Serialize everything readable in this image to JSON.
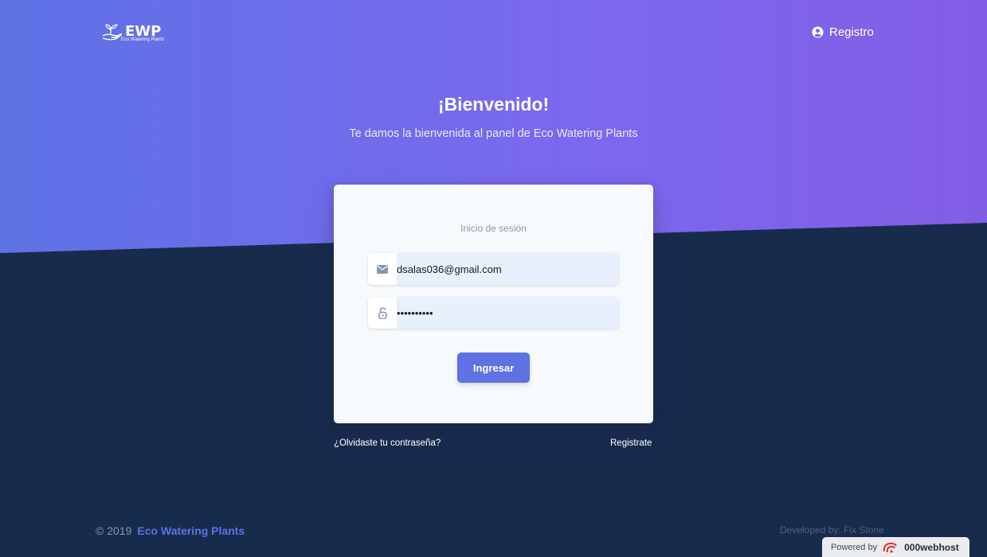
{
  "navbar": {
    "logo_title": "EWP",
    "logo_subtitle": "Eco Watering Plants",
    "register_label": "Registro",
    "register_icon": "user-circle-icon"
  },
  "hero": {
    "title": "¡Bienvenido!",
    "subtitle": "Te damos la bienvenida al panel de Eco Watering Plants"
  },
  "login_card": {
    "heading": "Inicio de sesión",
    "email": {
      "icon": "envelope-icon",
      "value": "dsalas036@gmail.com"
    },
    "password": {
      "icon": "lock-icon",
      "value": "••••••••••"
    },
    "submit_label": "Ingresar"
  },
  "links": {
    "forgot_password": "¿Olvidaste tu contraseña?",
    "register": "Registrate"
  },
  "footer": {
    "copyright": "© 2019",
    "brand": "Eco Watering Plants",
    "developed_by": "Developed by: Fix Stone"
  },
  "badge": {
    "powered_by": "Powered by",
    "host_name": "000webhost"
  },
  "colors": {
    "primary": "#5e72e4",
    "hero_gradient_start": "#5e72e4",
    "hero_gradient_end": "#825ee4",
    "background_dark": "#172b4d",
    "card_bg": "#f7fafc"
  }
}
